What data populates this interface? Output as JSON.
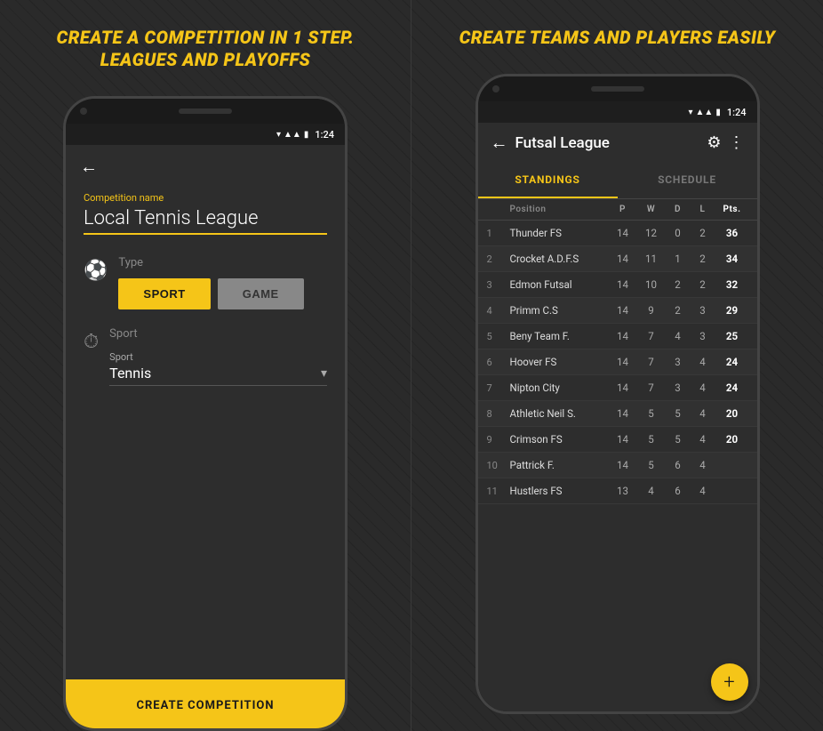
{
  "left_panel": {
    "title": "CREATE A COMPETITION IN 1 STEP.\nLEAGUES AND PLAYOFFS",
    "status_time": "1:24",
    "back_label": "←",
    "competition_name_label": "Competition name",
    "competition_name_value": "Local Tennis League",
    "type_label": "Type",
    "btn_sport_label": "SPORT",
    "btn_game_label": "GAME",
    "sport_section_label": "Sport",
    "sport_dropdown_label": "Sport",
    "sport_value": "Tennis",
    "create_btn_label": "CREATE COMPETITION"
  },
  "right_panel": {
    "title": "CREATE TEAMS AND PLAYERS EASILY",
    "status_time": "1:24",
    "app_title": "Futsal League",
    "tab_standings": "STANDINGS",
    "tab_schedule": "SCHEDULE",
    "columns": {
      "position": "Position",
      "p": "P",
      "w": "W",
      "d": "D",
      "l": "L",
      "pts": "Pts."
    },
    "rows": [
      {
        "pos": "1",
        "name": "Thunder FS",
        "p": "14",
        "w": "12",
        "d": "0",
        "l": "2",
        "pts": "36"
      },
      {
        "pos": "2",
        "name": "Crocket A.D.F.S",
        "p": "14",
        "w": "11",
        "d": "1",
        "l": "2",
        "pts": "34"
      },
      {
        "pos": "3",
        "name": "Edmon Futsal",
        "p": "14",
        "w": "10",
        "d": "2",
        "l": "2",
        "pts": "32"
      },
      {
        "pos": "4",
        "name": "Primm C.S",
        "p": "14",
        "w": "9",
        "d": "2",
        "l": "3",
        "pts": "29"
      },
      {
        "pos": "5",
        "name": "Beny Team F.",
        "p": "14",
        "w": "7",
        "d": "4",
        "l": "3",
        "pts": "25"
      },
      {
        "pos": "6",
        "name": "Hoover FS",
        "p": "14",
        "w": "7",
        "d": "3",
        "l": "4",
        "pts": "24"
      },
      {
        "pos": "7",
        "name": "Nipton City",
        "p": "14",
        "w": "7",
        "d": "3",
        "l": "4",
        "pts": "24"
      },
      {
        "pos": "8",
        "name": "Athletic Neil S.",
        "p": "14",
        "w": "5",
        "d": "5",
        "l": "4",
        "pts": "20"
      },
      {
        "pos": "9",
        "name": "Crimson FS",
        "p": "14",
        "w": "5",
        "d": "5",
        "l": "4",
        "pts": "20"
      },
      {
        "pos": "10",
        "name": "Pattrick F.",
        "p": "14",
        "w": "5",
        "d": "6",
        "l": "4",
        "pts": ""
      },
      {
        "pos": "11",
        "name": "Hustlers FS",
        "p": "13",
        "w": "4",
        "d": "6",
        "l": "4",
        "pts": ""
      }
    ],
    "fab_label": "+"
  }
}
